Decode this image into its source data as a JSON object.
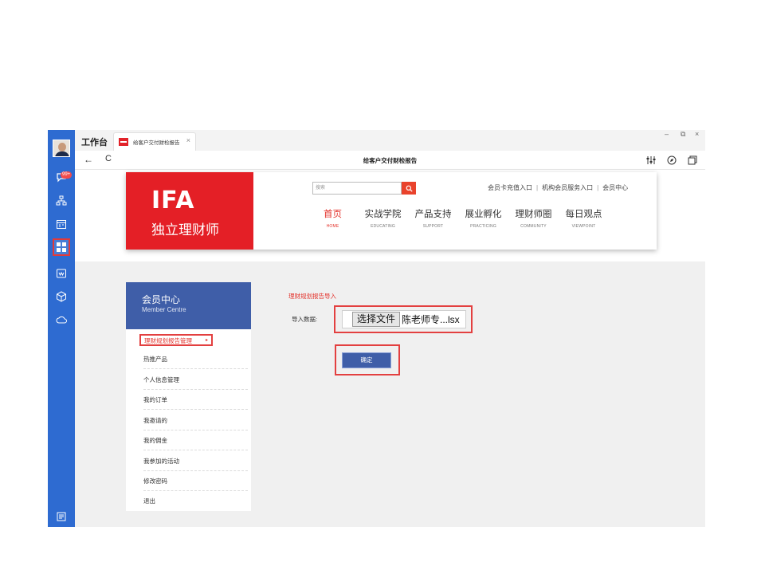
{
  "app": {
    "title": "工作台",
    "tab_label": "给客户交付财检报告",
    "tab_close": "×",
    "window_controls": {
      "minimize": "–",
      "restore": "⧉",
      "close": "×"
    },
    "page_title": "给客户交付财检报告",
    "back": "←",
    "reload": "C",
    "rail_badge": "99+",
    "rail_icons": [
      "chat-icon",
      "org-chart-icon",
      "calendar-icon",
      "workbench-grid-icon",
      "wechat-icon",
      "cube-icon",
      "cloud-icon",
      "notes-icon"
    ],
    "toolbar_icons": [
      "sliders-icon",
      "compass-icon",
      "window-icon"
    ]
  },
  "site": {
    "logo_mark": "IFA",
    "logo_text": "独立理财师",
    "search_placeholder": "搜索",
    "top_links": [
      "会员卡充值入口",
      "机构会员服务入口",
      "会员中心"
    ],
    "nav": [
      {
        "cn": "首页",
        "en": "HOME",
        "active": true
      },
      {
        "cn": "实战学院",
        "en": "EDUCATING"
      },
      {
        "cn": "产品支持",
        "en": "SUPPORT"
      },
      {
        "cn": "展业孵化",
        "en": "PRACTICING"
      },
      {
        "cn": "理财师圈",
        "en": "COMMUNITY"
      },
      {
        "cn": "每日观点",
        "en": "VIEWPOINT"
      }
    ],
    "brand_color": "#e41f26",
    "panel_color": "#3f5ea8"
  },
  "member": {
    "title": "会员中心",
    "subtitle": "Member Centre",
    "menu": [
      {
        "label": "理财规划报告管理",
        "active": true
      },
      {
        "label": "热推产品"
      },
      {
        "label": "个人信息管理"
      },
      {
        "label": "我的订单"
      },
      {
        "label": "我邀请的"
      },
      {
        "label": "我的佣金"
      },
      {
        "label": "我参加的活动"
      },
      {
        "label": "修改密码"
      },
      {
        "label": "退出"
      }
    ]
  },
  "import_form": {
    "title": "理财规划报告导入",
    "label": "导入数据:",
    "file_button": "选择文件",
    "file_name": "陈老师专...lsx",
    "confirm": "确定"
  }
}
